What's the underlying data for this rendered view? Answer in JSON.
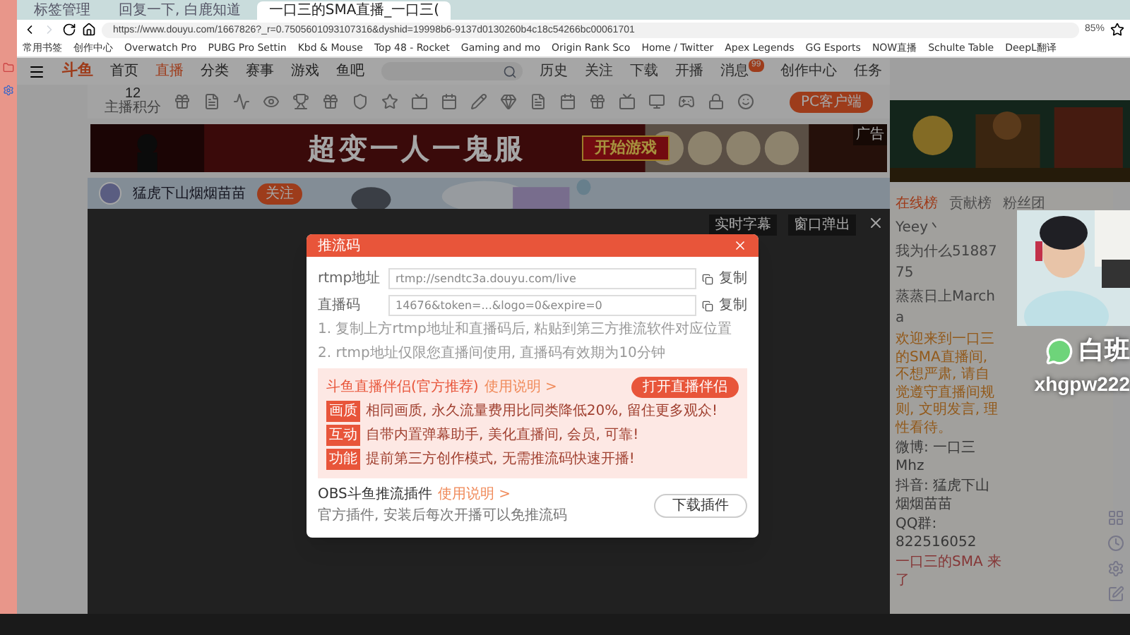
{
  "browser": {
    "tabs": [
      {
        "title": "标签管理",
        "selected": false
      },
      {
        "title": "回复一下, 白鹿知道",
        "selected": false
      },
      {
        "title": "一口三的SMA直播_一口三(",
        "selected": true
      }
    ],
    "url": "https://www.douyu.com/1667826?_r=0.7505601093107316&dyshid=19998b6-9137d0130260b4c18c54266bc00061701",
    "zoom": "85%",
    "bookmarks": [
      "常用书签",
      "创作中心",
      "Overwatch Pro",
      "PUBG Pro Settin",
      "Kbd & Mouse",
      "Top 48 - Rocket",
      "Gaming and mo",
      "Origin Rank Sco",
      "Home / Twitter",
      "Apex Legends",
      "GG Esports",
      "NOW直播",
      "Schulte Table",
      "DeepL翻译"
    ]
  },
  "site": {
    "logo": "斗鱼",
    "nav": [
      {
        "label": "首页",
        "selected": false
      },
      {
        "label": "直播",
        "selected": true
      },
      {
        "label": "分类",
        "selected": false
      },
      {
        "label": "赛事",
        "selected": false
      },
      {
        "label": "游戏",
        "selected": false
      },
      {
        "label": "鱼吧",
        "selected": false
      }
    ],
    "header_actions": [
      "历史",
      "关注",
      "下载",
      "开播",
      "消息",
      "创作中心",
      "任务"
    ],
    "message_count": "99",
    "points": "12",
    "points_label": "主播积分",
    "client_button": "PC客户端"
  },
  "banner": {
    "title": "超变一人一鬼服",
    "button": "开始游戏",
    "ad_tag": "广告"
  },
  "streamer": {
    "name": "猛虎下山烟烟苗苗",
    "follow": "关注",
    "actions": [
      "实时字幕",
      "窗口弹出"
    ]
  },
  "modal": {
    "title": "推流码",
    "fields": [
      {
        "label": "rtmp地址",
        "value": "rtmp://sendtc3a.douyu.com/live",
        "copy": "复制"
      },
      {
        "label": "直播码",
        "value": "14676&token=...&logo=0&expire=0",
        "copy": "复制"
      }
    ],
    "notes": [
      "1. 复制上方rtmp地址和直播码后, 粘贴到第三方推流软件对应位置",
      "2. rtmp地址仅限您直播间使用, 直播码有效期为10分钟"
    ],
    "promo": {
      "title": "斗鱼直播伴侣(官方推荐)",
      "link": "使用说明 >",
      "button": "打开直播伴侣",
      "items": [
        {
          "tag": "画质",
          "text": "相同画质, 永久流量费用比同类降低20%, 留住更多观众!"
        },
        {
          "tag": "互动",
          "text": "自带内置弹幕助手, 美化直播间, 会员, 可靠!"
        },
        {
          "tag": "功能",
          "text": "提前第三方创作模式, 无需推流码快速开播!"
        }
      ]
    },
    "plugin": {
      "title": "OBS斗鱼推流插件",
      "link": "使用说明 >",
      "text": "官方插件, 安装后每次开播可以免推流码",
      "button": "下载插件"
    }
  },
  "chat": {
    "tabs": [
      {
        "label": "在线榜",
        "selected": true
      },
      {
        "label": "贡献榜",
        "selected": false
      },
      {
        "label": "粉丝团",
        "selected": false
      }
    ],
    "messages": [
      "Yeey丶",
      "我为什么5188775",
      "蒸蒸日上Marcha"
    ],
    "notice": "欢迎来到一口三的SMA直播间, 不想严肃, 请自觉遵守直播间规则, 文明发言, 理性看待。",
    "info": [
      "微博: 一口三Mhz",
      "抖音: 猛虎下山烟烟苗苗",
      "QQ群: 822516052"
    ],
    "last": "一口三的SMA 来了"
  },
  "overlay": {
    "title": "白班",
    "code": "xhgpw222"
  }
}
